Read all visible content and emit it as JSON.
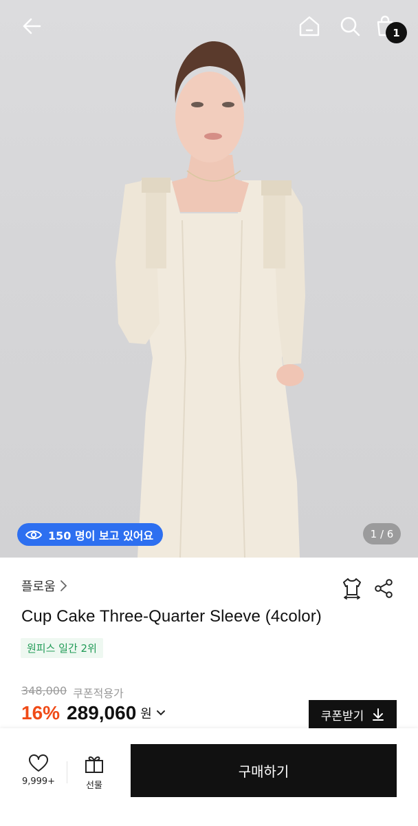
{
  "header": {
    "cart_count": "1"
  },
  "hero": {
    "viewers_text": "150 명이 보고 있어요",
    "image_counter": "1 / 6"
  },
  "product": {
    "brand": "플로움",
    "title": "Cup Cake Three-Quarter Sleeve (4color)",
    "rank_badge": "원피스 일간 2위",
    "original_price": "348,000",
    "coupon_applied_label": "쿠폰적용가",
    "discount_rate": "16%",
    "price": "289,060",
    "currency": "원",
    "coupon_button_label": "쿠폰받기"
  },
  "bottom_bar": {
    "like_count": "9,999+",
    "gift_label": "선물",
    "buy_label": "구매하기"
  },
  "colors": {
    "viewers_pill": "#2d6ff0",
    "discount": "#f04b17",
    "rank_badge_text": "#1f9a55",
    "rank_badge_bg": "#eef8f1",
    "primary_button": "#111111"
  },
  "icons": [
    "back-arrow-icon",
    "home-icon",
    "search-icon",
    "shopping-bag-icon",
    "eye-icon",
    "chevron-right-icon",
    "fitting-shirt-icon",
    "share-icon",
    "chevron-down-icon",
    "download-icon",
    "heart-icon",
    "gift-icon"
  ]
}
